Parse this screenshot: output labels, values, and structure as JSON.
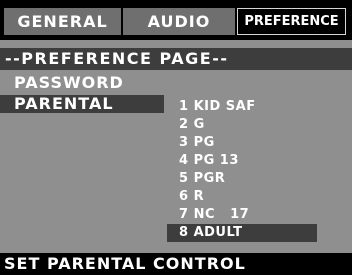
{
  "tabs": [
    {
      "label": "GENERAL"
    },
    {
      "label": "AUDIO"
    },
    {
      "label": "PREFERENCE"
    }
  ],
  "page_title": "--PREFERENCE PAGE--",
  "menu": {
    "password": "PASSWORD",
    "parental": "PARENTAL"
  },
  "parental_options": [
    "1 KID SAF",
    "2 G",
    "3 PG",
    "4 PG 13",
    "5 PGR",
    "6 R",
    "7 NC   17",
    "8 ADULT"
  ],
  "selected_option": "8 ADULT",
  "status": "SET PARENTAL CONTROL",
  "colors": {
    "background": "#000000",
    "panel": "#8f8f8f",
    "tab": "#6f6f6f",
    "highlight": "#3d3d3d",
    "text": "#ffffff"
  }
}
